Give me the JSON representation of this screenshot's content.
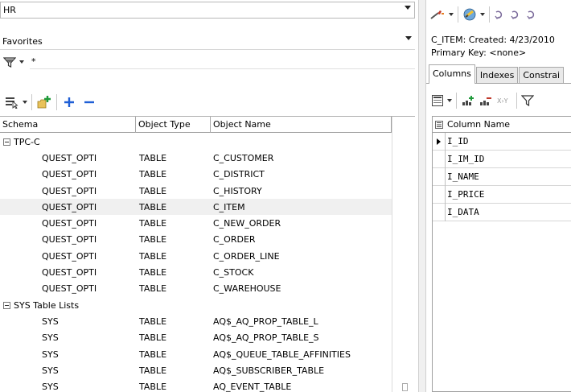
{
  "schema_combo": {
    "value": "HR"
  },
  "favorites_combo": {
    "value": "Favorites"
  },
  "filter": {
    "value": "*"
  },
  "grid": {
    "headers": [
      "Schema",
      "Object Type",
      "Object Name"
    ],
    "groups": [
      {
        "label": "TPC-C",
        "rows": [
          [
            "QUEST_OPTI",
            "TABLE",
            "C_CUSTOMER"
          ],
          [
            "QUEST_OPTI",
            "TABLE",
            "C_DISTRICT"
          ],
          [
            "QUEST_OPTI",
            "TABLE",
            "C_HISTORY"
          ],
          [
            "QUEST_OPTI",
            "TABLE",
            "C_ITEM"
          ],
          [
            "QUEST_OPTI",
            "TABLE",
            "C_NEW_ORDER"
          ],
          [
            "QUEST_OPTI",
            "TABLE",
            "C_ORDER"
          ],
          [
            "QUEST_OPTI",
            "TABLE",
            "C_ORDER_LINE"
          ],
          [
            "QUEST_OPTI",
            "TABLE",
            "C_STOCK"
          ],
          [
            "QUEST_OPTI",
            "TABLE",
            "C_WAREHOUSE"
          ]
        ]
      },
      {
        "label": "SYS Table Lists",
        "rows": [
          [
            "SYS",
            "TABLE",
            "AQ$_AQ_PROP_TABLE_L"
          ],
          [
            "SYS",
            "TABLE",
            "AQ$_AQ_PROP_TABLE_S"
          ],
          [
            "SYS",
            "TABLE",
            "AQ$_QUEUE_TABLE_AFFINITIES"
          ],
          [
            "SYS",
            "TABLE",
            "AQ$_SUBSCRIBER_TABLE"
          ],
          [
            "SYS",
            "TABLE",
            "AQ_EVENT_TABLE"
          ]
        ]
      }
    ],
    "highlighted_row": "C_ITEM"
  },
  "detail": {
    "title_line": "C_ITEM:  Created: 4/23/2010",
    "primary_key_line": "Primary Key:  <none>",
    "tabs": [
      "Columns",
      "Indexes",
      "Constrai"
    ],
    "active_tab": "Columns",
    "column_header": "Column Name",
    "columns": [
      "I_ID",
      "I_IM_ID",
      "I_NAME",
      "I_PRICE",
      "I_DATA"
    ]
  },
  "colors": {
    "add_plus": "#1f5fd6",
    "remove_minus": "#1f5fd6",
    "highlight_row": "#f0f0f0"
  },
  "icons": [
    "filter-funnel-icon",
    "object-list-icon",
    "add-favorite-icon",
    "plus-icon",
    "minus-icon",
    "wrench-icon",
    "database-icon",
    "refresh-icon",
    "grid-options-icon",
    "add-column-icon",
    "remove-column-icon",
    "xy-icon",
    "filter-icon"
  ]
}
